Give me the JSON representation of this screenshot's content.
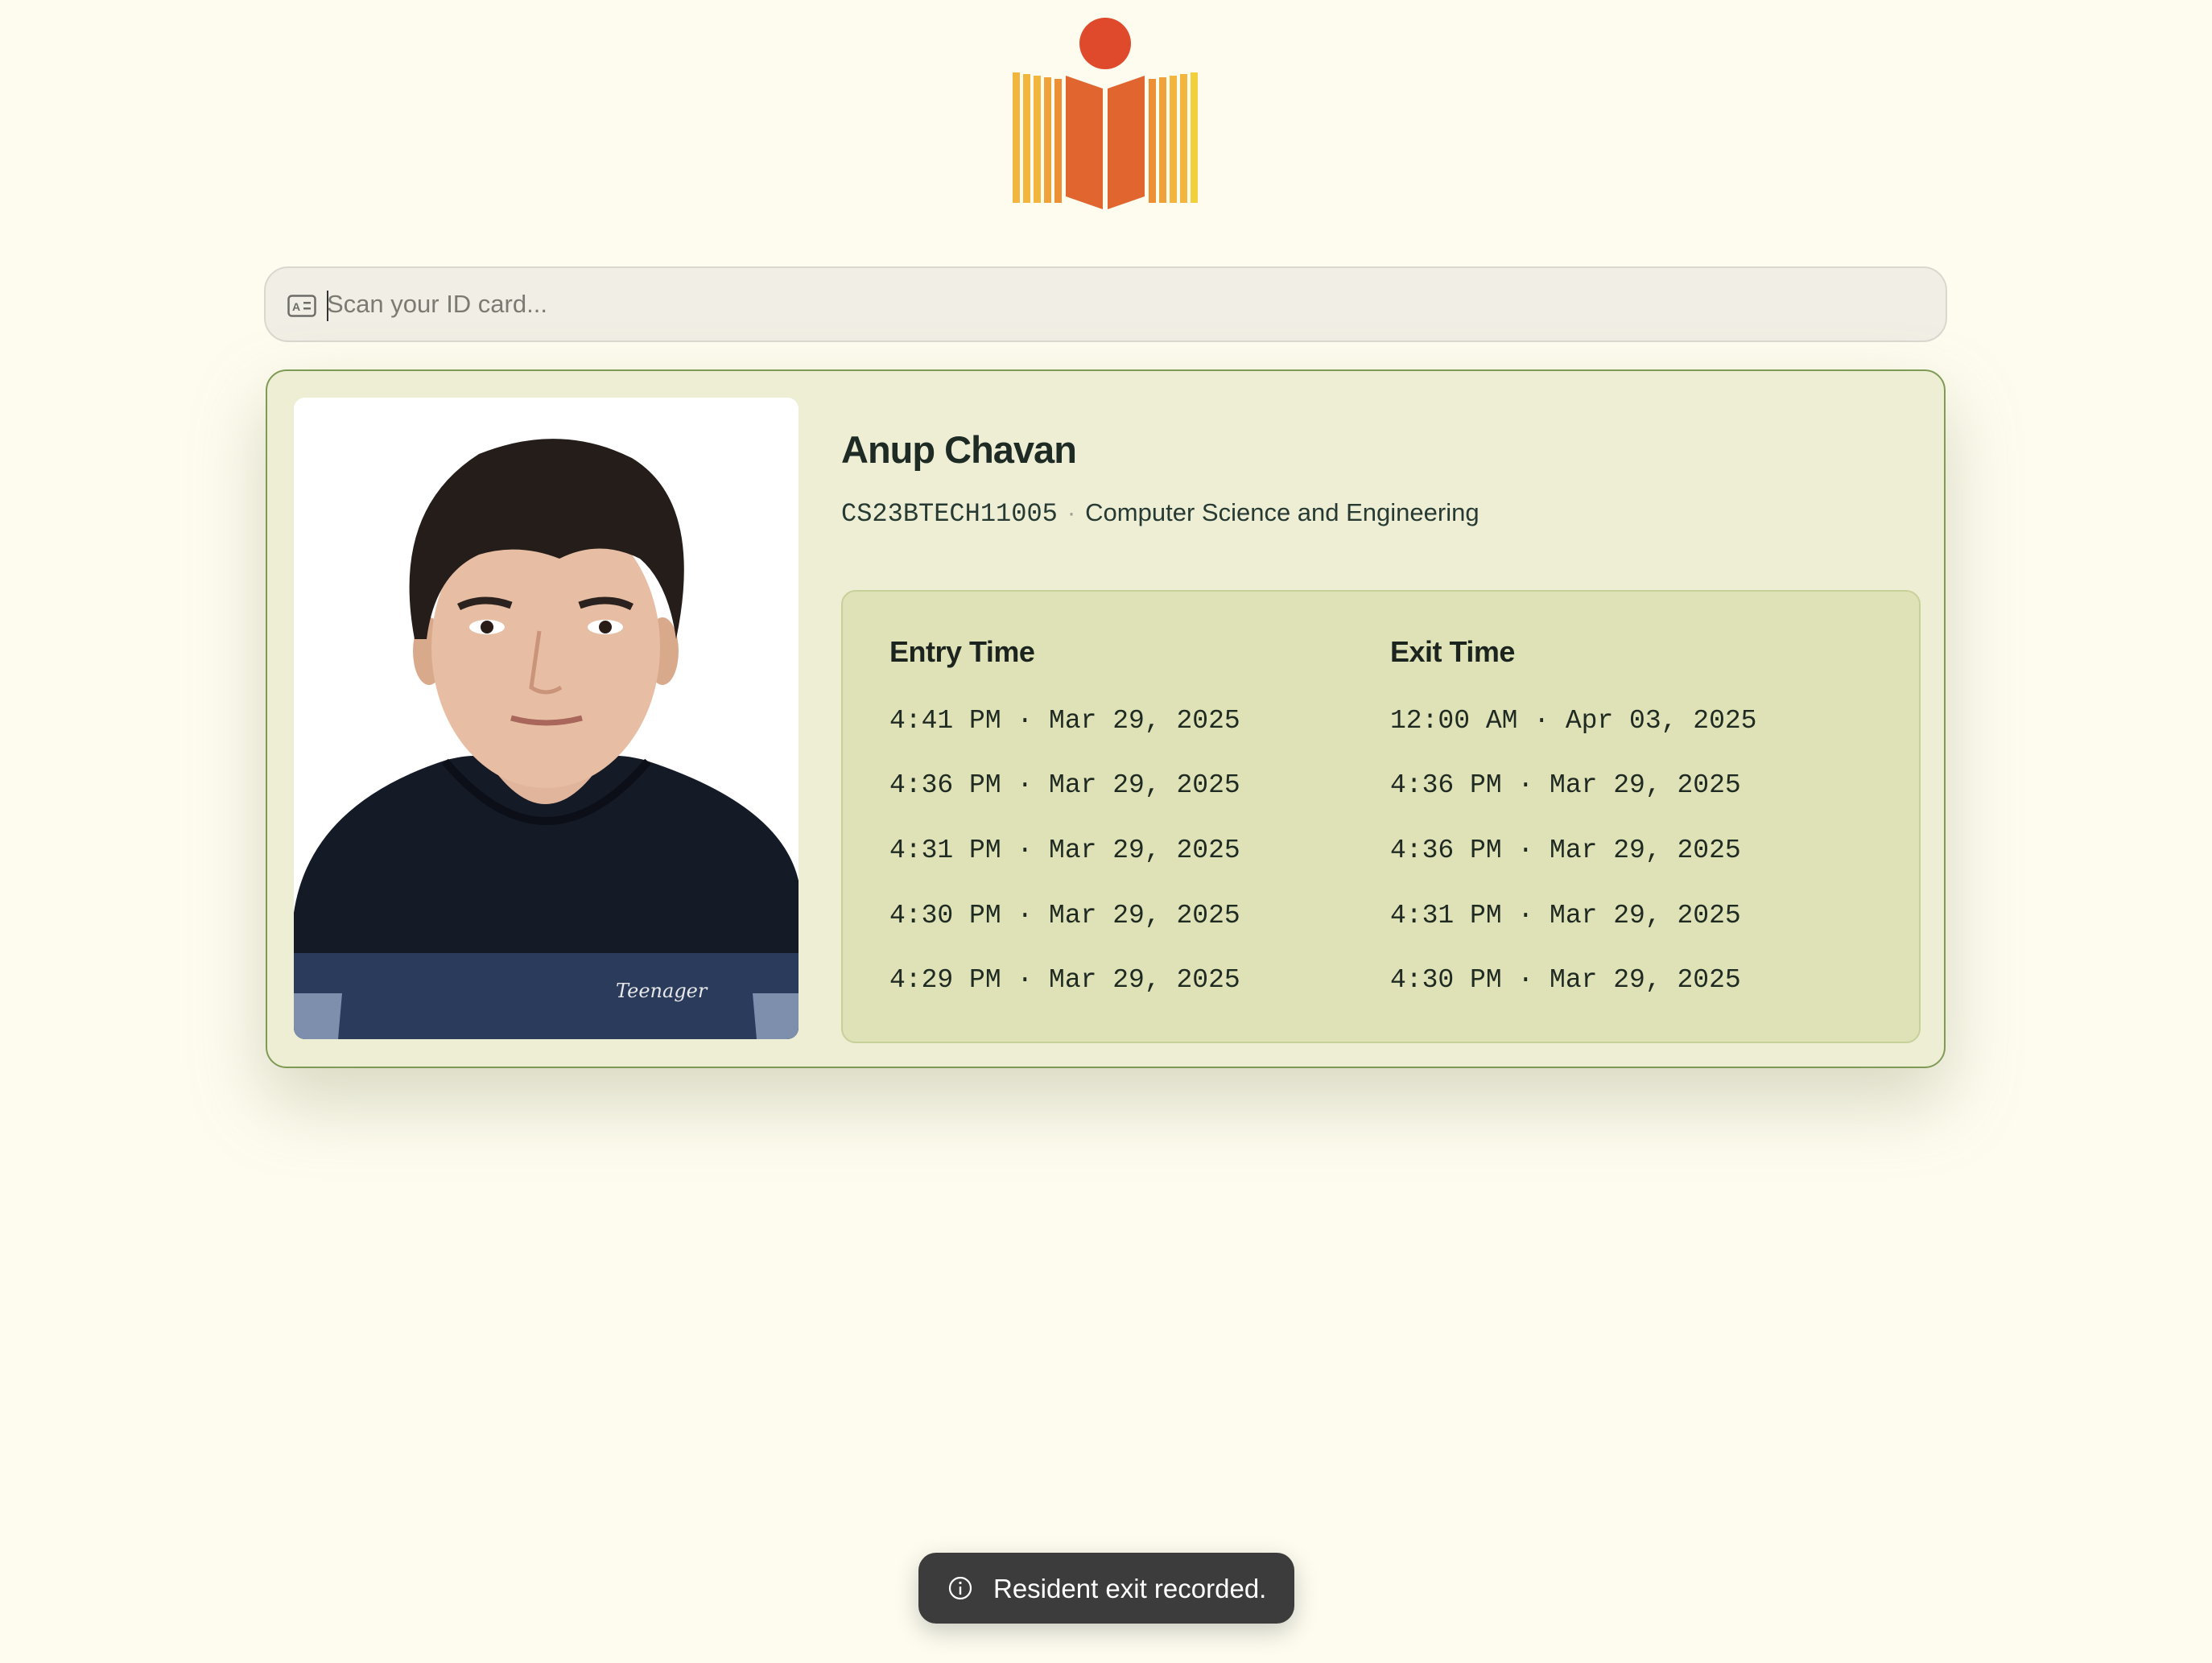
{
  "header": {
    "logo_icon": "institute-logo-icon"
  },
  "scan": {
    "placeholder": "Scan your ID card...",
    "value": "",
    "icon": "id-card-icon"
  },
  "student": {
    "name": "Anup Chavan",
    "roll": "CS23BTECH11005",
    "separator": "·",
    "department": "Computer Science and Engineering",
    "photo": "student-photo"
  },
  "log": {
    "entry_header": "Entry Time",
    "exit_header": "Exit Time",
    "entries": [
      "4:41 PM · Mar 29, 2025",
      "4:36 PM · Mar 29, 2025",
      "4:31 PM · Mar 29, 2025",
      "4:30 PM · Mar 29, 2025",
      "4:29 PM · Mar 29, 2025"
    ],
    "exits": [
      "12:00 AM · Apr 03, 2025",
      "4:36 PM · Mar 29, 2025",
      "4:36 PM · Mar 29, 2025",
      "4:31 PM · Mar 29, 2025",
      "4:30 PM · Mar 29, 2025"
    ]
  },
  "toast": {
    "icon": "info-icon",
    "message": "Resident exit recorded."
  },
  "colors": {
    "background": "#fdfcef",
    "card": "#edeed4",
    "card_border": "#7f9a55",
    "log_panel": "#dfe2b6",
    "logo_orange": "#e0652f",
    "logo_yellow": "#f2b53d",
    "logo_red": "#de4a2b",
    "toast": "#3c3c3c"
  }
}
